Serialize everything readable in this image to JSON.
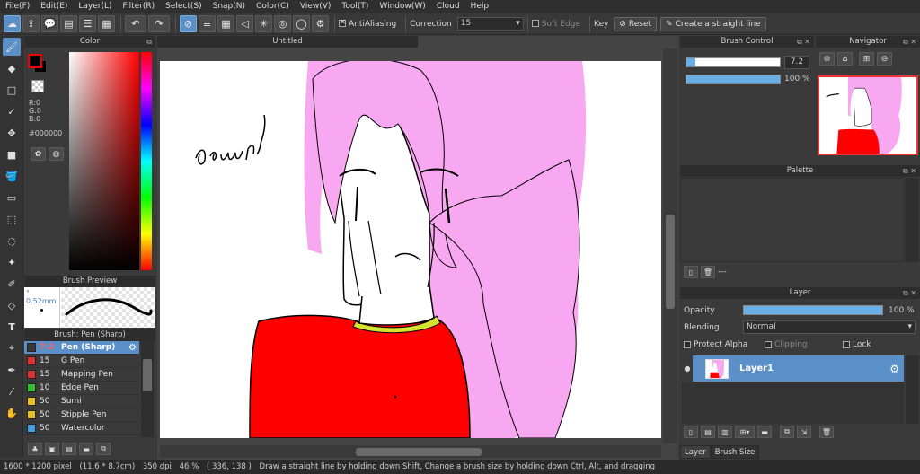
{
  "menu": [
    "File(F)",
    "Edit(E)",
    "Layer(L)",
    "Filter(R)",
    "Select(S)",
    "Snap(N)",
    "Color(C)",
    "View(V)",
    "Tool(T)",
    "Window(W)",
    "Cloud",
    "Help"
  ],
  "toolbar": {
    "antialiasing_label": "AntiAliasing",
    "correction_label": "Correction",
    "correction_value": "15",
    "soft_edge_label": "Soft Edge",
    "key_label": "Key",
    "reset_label": "Reset",
    "straight_line_label": "Create a straight line"
  },
  "color_panel": {
    "title": "Color",
    "r": "R:0",
    "g": "G:0",
    "b": "B:0",
    "hex": "#000000",
    "foreground": "#000000"
  },
  "brush_preview": {
    "title": "Brush Preview",
    "size": "0.52mm"
  },
  "brush_list": {
    "title": "Brush: Pen (Sharp)",
    "items": [
      {
        "size": "7.2",
        "name": "Pen (Sharp)",
        "color": "#3a3a3a"
      },
      {
        "size": "15",
        "name": "G Pen",
        "color": "#e03030"
      },
      {
        "size": "15",
        "name": "Mapping Pen",
        "color": "#e03030"
      },
      {
        "size": "10",
        "name": "Edge Pen",
        "color": "#30c030"
      },
      {
        "size": "50",
        "name": "Sumi",
        "color": "#e8c020"
      },
      {
        "size": "50",
        "name": "Stipple Pen",
        "color": "#e8c020"
      },
      {
        "size": "50",
        "name": "Watercolor",
        "color": "#40a0e0"
      }
    ]
  },
  "canvas": {
    "tab_title": "Untitled",
    "text_written": "demo!"
  },
  "brush_control": {
    "title": "Brush Control",
    "size_value": "7.2",
    "size_fraction": 0.1,
    "opacity_value": "100 %",
    "opacity_fraction": 1.0
  },
  "navigator": {
    "title": "Navigator"
  },
  "palette": {
    "title": "Palette",
    "empty_label": "---"
  },
  "layer": {
    "title": "Layer",
    "opacity_label": "Opacity",
    "opacity_value": "100 %",
    "opacity_fraction": 1.0,
    "blending_label": "Blending",
    "blending_value": "Normal",
    "protect_alpha": "Protect Alpha",
    "clipping": "Clipping",
    "lock": "Lock",
    "layer_name": "Layer1",
    "tabs": [
      "Layer",
      "Brush Size"
    ]
  },
  "status": {
    "size": "1600 * 1200 pixel",
    "physical": "(11.6 * 8.7cm)",
    "dpi": "350 dpi",
    "zoom": "46 %",
    "cursor": "( 336, 138 )",
    "hint": "Draw a straight line by holding down Shift, Change a brush size by holding down Ctrl, Alt, and dragging"
  },
  "colors": {
    "accent": "#5b8fc8",
    "hair": "#f7a8f0",
    "shirt": "#ff0000",
    "collar": "#d8e030"
  }
}
